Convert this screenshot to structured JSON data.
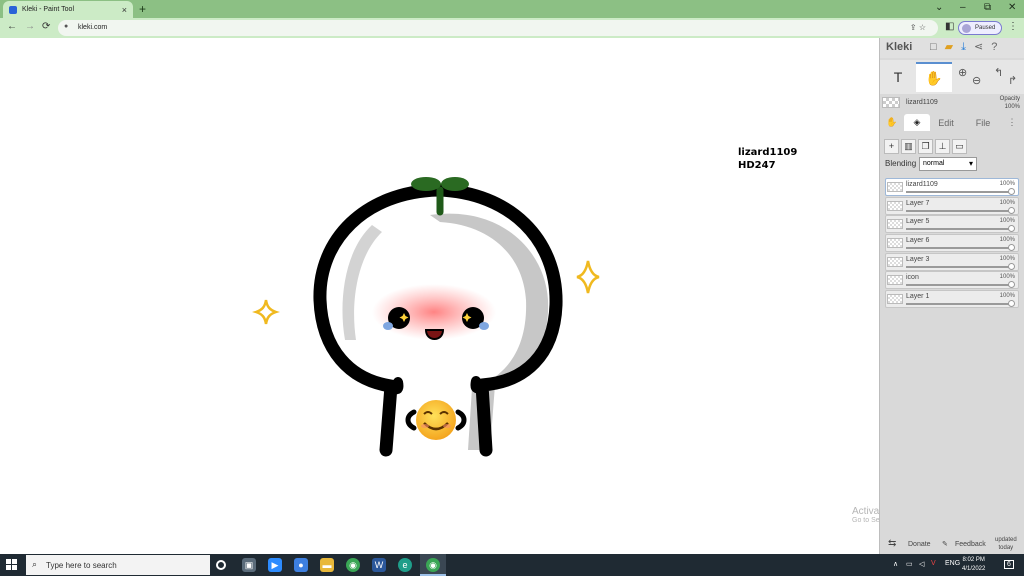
{
  "browser": {
    "tab_title": "Kleki - Paint Tool",
    "tab_close": "×",
    "new_tab": "+",
    "url": "kleki.com",
    "profile_label": "Paused",
    "window_controls": [
      "‒",
      "⧉",
      "✕"
    ],
    "back": "←",
    "forward": "→",
    "reload": "⟳",
    "lock": "🔒"
  },
  "canvas": {
    "signature_line1": "lizard1109",
    "signature_line2": "HD247"
  },
  "panel": {
    "logo": "Kleki",
    "opacity_label": "Opacity",
    "opacity_value": "100%",
    "brush_name": "lizard1109",
    "tabs": {
      "edit": "Edit",
      "file": "File"
    },
    "blending_label": "Blending",
    "blending_value": "normal",
    "layers": [
      {
        "name": "lizard1109",
        "opacity": "100%"
      },
      {
        "name": "Layer 7",
        "opacity": "100%"
      },
      {
        "name": "Layer 5",
        "opacity": "100%"
      },
      {
        "name": "Layer 6",
        "opacity": "100%"
      },
      {
        "name": "Layer 3",
        "opacity": "100%"
      },
      {
        "name": "icon",
        "opacity": "100%"
      },
      {
        "name": "Layer 1",
        "opacity": "100%"
      }
    ],
    "bottom": {
      "donate": "Donate",
      "feedback": "Feedback",
      "updated_line1": "updated",
      "updated_line2": "today"
    }
  },
  "watermark": {
    "line1": "Activate Windows",
    "line2": "Go to Settings to activate Windows."
  },
  "taskbar": {
    "search_placeholder": "Type here to search",
    "lang": "ENG",
    "time": "8:02 PM",
    "date": "4/1/2022"
  }
}
